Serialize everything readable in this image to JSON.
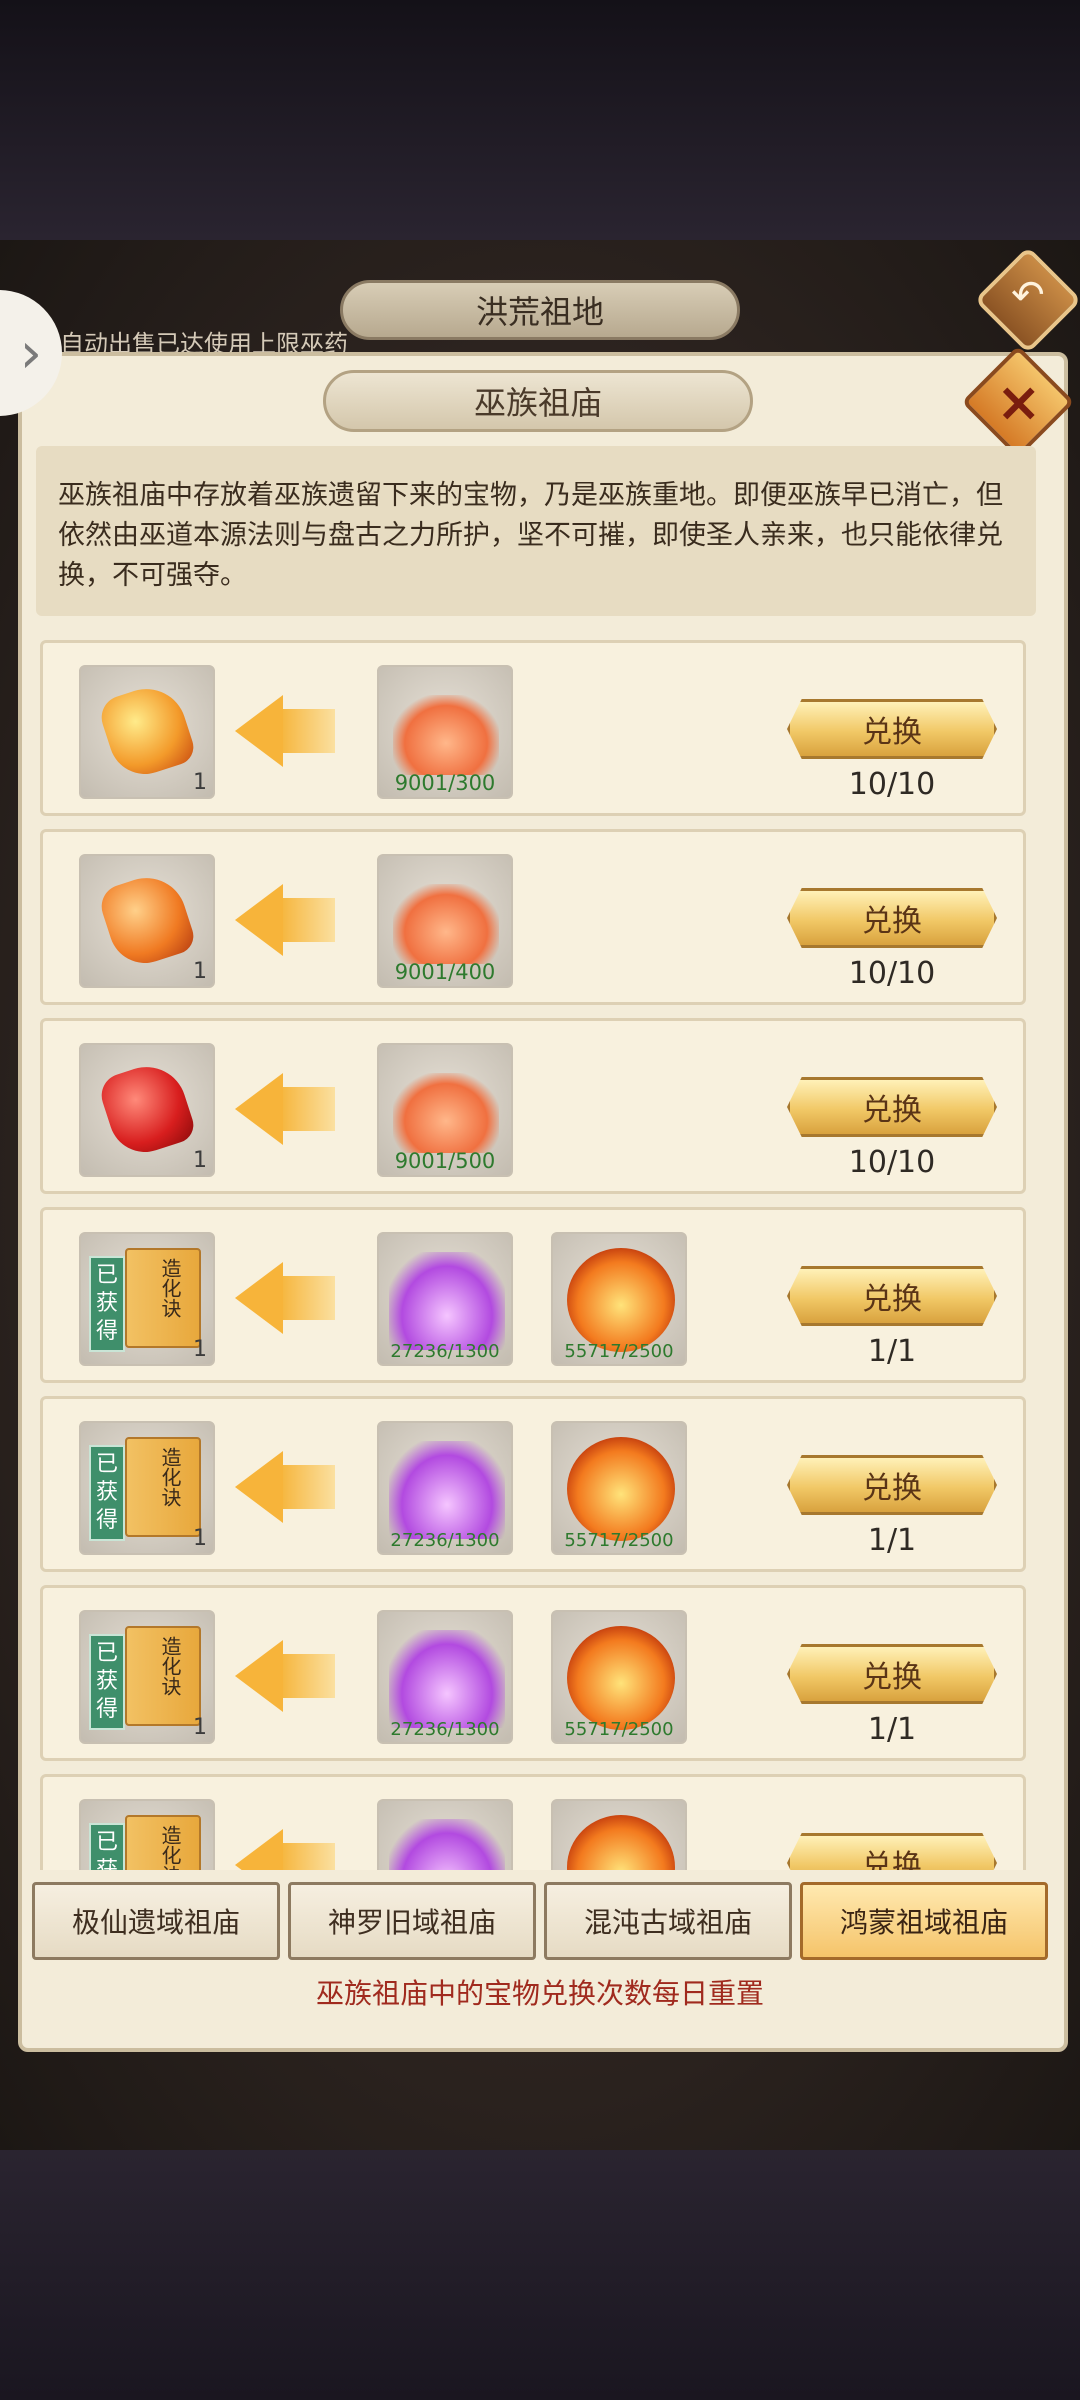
{
  "header": {
    "outer_title": "洪荒祖地",
    "auto_sell_notice": "自动出售已达使用上限巫药"
  },
  "panel": {
    "title": "巫族祖庙",
    "description": "巫族祖庙中存放着巫族遗留下来的宝物，乃是巫族重地。即便巫族早已消亡，但依然由巫道本源法则与盘古之力所护，坚不可摧，即使圣人亲来，也只能依律兑换，不可强夺。"
  },
  "rows": [
    {
      "reward_icon": "golden-gem-icon",
      "reward_count": "1",
      "costs": [
        {
          "icon": "red-cloud-icon",
          "text": "9001/300"
        }
      ],
      "button": "兑换",
      "limit": "10/10"
    },
    {
      "reward_icon": "orange-gem-icon",
      "reward_count": "1",
      "costs": [
        {
          "icon": "red-cloud-icon",
          "text": "9001/400"
        }
      ],
      "button": "兑换",
      "limit": "10/10"
    },
    {
      "reward_icon": "red-gem-icon",
      "reward_count": "1",
      "costs": [
        {
          "icon": "red-cloud-icon",
          "text": "9001/500"
        }
      ],
      "button": "兑换",
      "limit": "10/10"
    },
    {
      "reward_icon": "scroll-book-icon",
      "reward_badge": "已获得",
      "reward_book_text": "造化诀",
      "reward_count": "1",
      "costs": [
        {
          "icon": "purple-aura-icon",
          "text": "27236/1300"
        },
        {
          "icon": "fire-orb-icon",
          "text": "55717/2500"
        }
      ],
      "button": "兑换",
      "limit": "1/1"
    },
    {
      "reward_icon": "scroll-book-icon",
      "reward_badge": "已获得",
      "reward_book_text": "造化诀",
      "reward_count": "1",
      "costs": [
        {
          "icon": "purple-aura-icon",
          "text": "27236/1300"
        },
        {
          "icon": "fire-orb-icon",
          "text": "55717/2500"
        }
      ],
      "button": "兑换",
      "limit": "1/1"
    },
    {
      "reward_icon": "scroll-book-icon",
      "reward_badge": "已获得",
      "reward_book_text": "造化诀",
      "reward_count": "1",
      "costs": [
        {
          "icon": "purple-aura-icon",
          "text": "27236/1300"
        },
        {
          "icon": "fire-orb-icon",
          "text": "55717/2500"
        }
      ],
      "button": "兑换",
      "limit": "1/1"
    },
    {
      "reward_icon": "scroll-book-icon",
      "reward_badge": "已获得",
      "reward_book_text": "造化诀",
      "reward_count": "",
      "costs": [
        {
          "icon": "purple-aura-icon",
          "text": ""
        },
        {
          "icon": "fire-orb-icon",
          "text": ""
        }
      ],
      "button": "兑换",
      "limit": ""
    }
  ],
  "tabs": [
    {
      "label": "极仙遗域祖庙",
      "active": false
    },
    {
      "label": "神罗旧域祖庙",
      "active": false
    },
    {
      "label": "混沌古域祖庙",
      "active": false
    },
    {
      "label": "鸿蒙祖域祖庙",
      "active": true
    }
  ],
  "footer": {
    "notice": "巫族祖庙中的宝物兑换次数每日重置"
  },
  "icons": {
    "back": "back-arrow-icon",
    "close": "close-icon",
    "side": "chevron-right-icon"
  }
}
